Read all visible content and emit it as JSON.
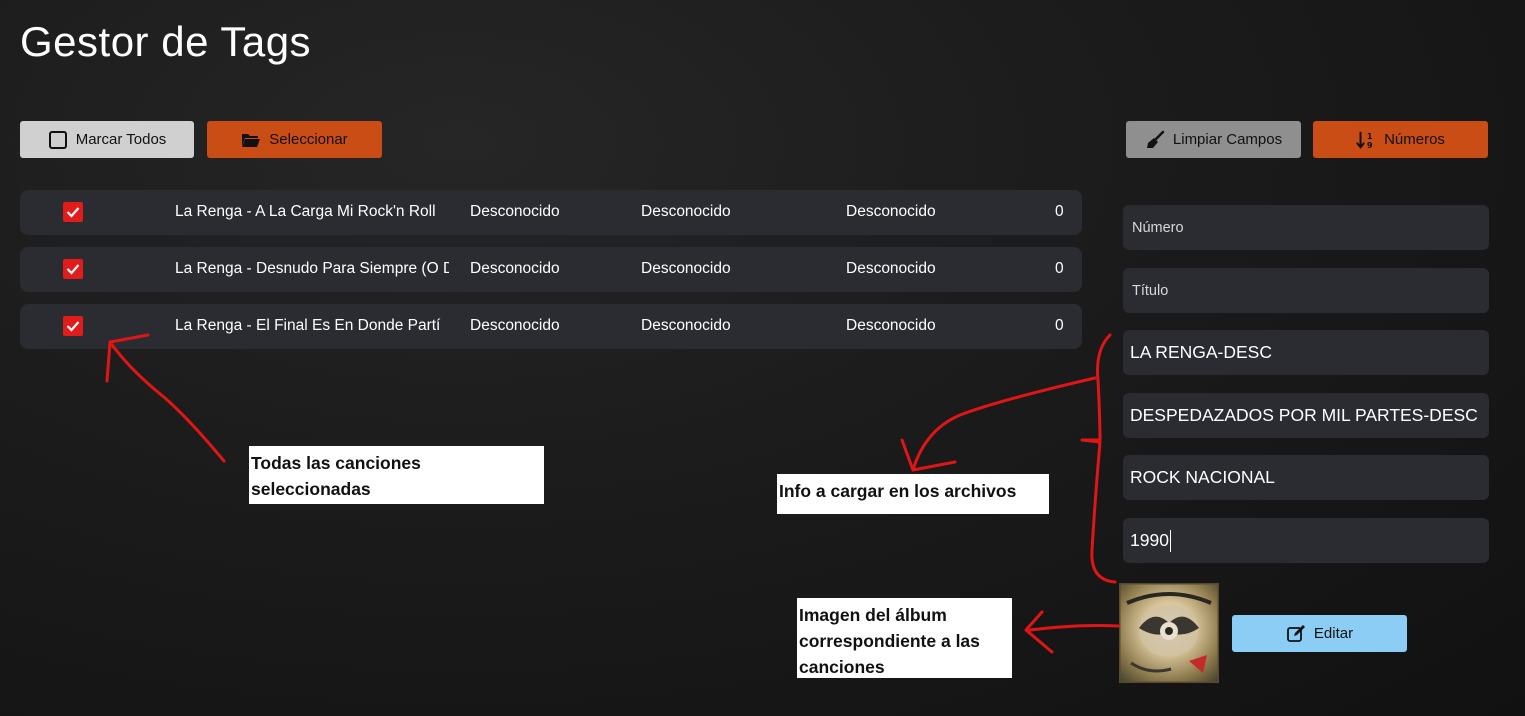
{
  "app": {
    "title": "Gestor de Tags"
  },
  "toolbar": {
    "mark_all_label": "Marcar Todos",
    "select_label": "Seleccionar",
    "clear_fields_label": "Limpiar Campos",
    "numbers_label": "Números"
  },
  "songs": [
    {
      "checked": true,
      "title": "La Renga - A La Carga Mi Rock'n Roll",
      "artist": "Desconocido",
      "album": "Desconocido",
      "genre": "Desconocido",
      "number": "0"
    },
    {
      "checked": true,
      "title": "La Renga - Desnudo Para Siempre (O D",
      "artist": "Desconocido",
      "album": "Desconocido",
      "genre": "Desconocido",
      "number": "0"
    },
    {
      "checked": true,
      "title": "La Renga - El Final Es En Donde Partí",
      "artist": "Desconocido",
      "album": "Desconocido",
      "genre": "Desconocido",
      "number": "0"
    }
  ],
  "form": {
    "number_placeholder": "Número",
    "title_placeholder": "Título",
    "artist_value": "LA RENGA-DESC",
    "album_value": "DESPEDAZADOS POR MIL PARTES-DESC",
    "genre_value": "ROCK NACIONAL",
    "year_value": "1990",
    "edit_label": "Editar"
  },
  "annotations": {
    "all_selected": "Todas las canciones seleccionadas",
    "info_to_load": "Info a cargar en los archivos",
    "album_image": "Imagen del álbum correspondiente a las canciones"
  },
  "icons": {
    "mark_all": "checkbox-empty-icon",
    "select": "folder-open-icon",
    "clear": "broom-icon",
    "numbers": "sort-numeric-icon",
    "edit": "edit-icon",
    "row_check": "checkbox-checked-icon"
  },
  "colors": {
    "accent_orange": "#c94d14",
    "checkbox_red": "#e21b1b",
    "edit_blue": "#8ccdf6",
    "annotation_red": "#e01616"
  }
}
